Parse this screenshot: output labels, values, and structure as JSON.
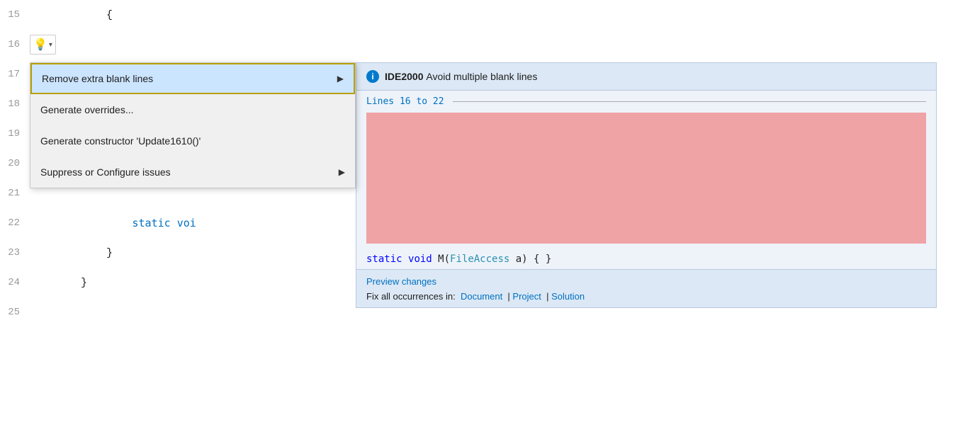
{
  "editor": {
    "lines": [
      {
        "num": "15",
        "content": "    {"
      },
      {
        "num": "16",
        "content": ""
      },
      {
        "num": "17",
        "content": ""
      },
      {
        "num": "18",
        "content": ""
      },
      {
        "num": "19",
        "content": ""
      },
      {
        "num": "20",
        "content": ""
      },
      {
        "num": "21",
        "content": ""
      },
      {
        "num": "22",
        "content": "        static voi"
      },
      {
        "num": "23",
        "content": "    }"
      },
      {
        "num": "24",
        "content": "}"
      },
      {
        "num": "25",
        "content": ""
      }
    ]
  },
  "lightbulb": {
    "icon": "💡",
    "arrow": "▾"
  },
  "menu": {
    "items": [
      {
        "id": "remove-blank-lines",
        "label": "Remove extra blank lines",
        "hasArrow": true,
        "highlighted": true
      },
      {
        "id": "generate-overrides",
        "label": "Generate overrides...",
        "hasArrow": false,
        "highlighted": false
      },
      {
        "id": "generate-constructor",
        "label": "Generate constructor 'Update1610()'",
        "hasArrow": false,
        "highlighted": false
      },
      {
        "id": "suppress-configure",
        "label": "Suppress or Configure issues",
        "hasArrow": true,
        "highlighted": false
      }
    ],
    "arrowSymbol": "▶"
  },
  "preview": {
    "info_icon": "i",
    "title_code": "IDE2000",
    "title_text": "Avoid multiple blank lines",
    "lines_range": "Lines 16 to 22",
    "code_line": "static void M(FileAccess a) { }",
    "footer": {
      "preview_changes": "Preview changes",
      "fix_all_prefix": "Fix all occurrences in:",
      "fix_links": [
        "Document",
        "Project",
        "Solution"
      ],
      "separator": "|"
    }
  }
}
